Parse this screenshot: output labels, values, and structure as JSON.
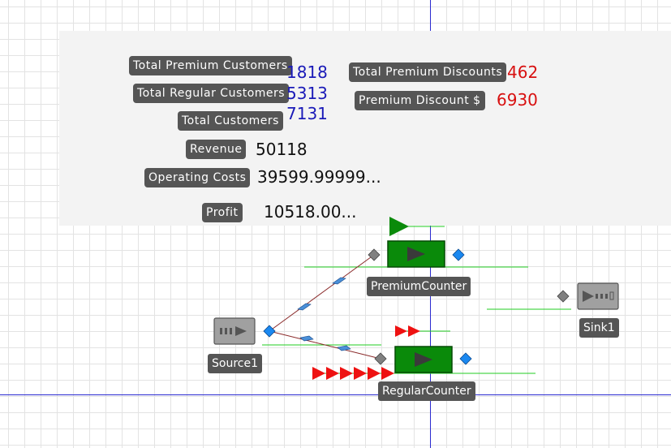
{
  "stats": {
    "total_premium_customers": {
      "label": "Total  Premium  Customers",
      "value": "1818"
    },
    "total_regular_customers": {
      "label": "Total  Regular  Customers",
      "value": "5313"
    },
    "total_customers": {
      "label": "Total  Customers",
      "value": "7131"
    },
    "total_premium_discounts": {
      "label": "Total  Premium  Discounts",
      "value": "462"
    },
    "premium_discount": {
      "label": "Premium  Discount  $",
      "value": "6930"
    },
    "revenue": {
      "label": "Revenue",
      "value": "50118"
    },
    "operating_costs": {
      "label": "Operating  Costs",
      "value": "39599.99999..."
    },
    "profit": {
      "label": "Profit",
      "value": "10518.00..."
    }
  },
  "model": {
    "source": {
      "label": "Source1",
      "icon": "source-icon"
    },
    "premium_counter": {
      "label": "PremiumCounter",
      "icon": "server-icon"
    },
    "regular_counter": {
      "label": "RegularCounter",
      "icon": "server-icon"
    },
    "sink": {
      "label": "Sink1",
      "icon": "sink-icon"
    }
  },
  "colors": {
    "axis": "#2a2ad0",
    "counter_green": "#0a8a0a",
    "value_blue": "#1a1ab8",
    "value_red": "#d81010",
    "node_diamond": "#1a88f0",
    "connector": "#8a2a2a"
  }
}
